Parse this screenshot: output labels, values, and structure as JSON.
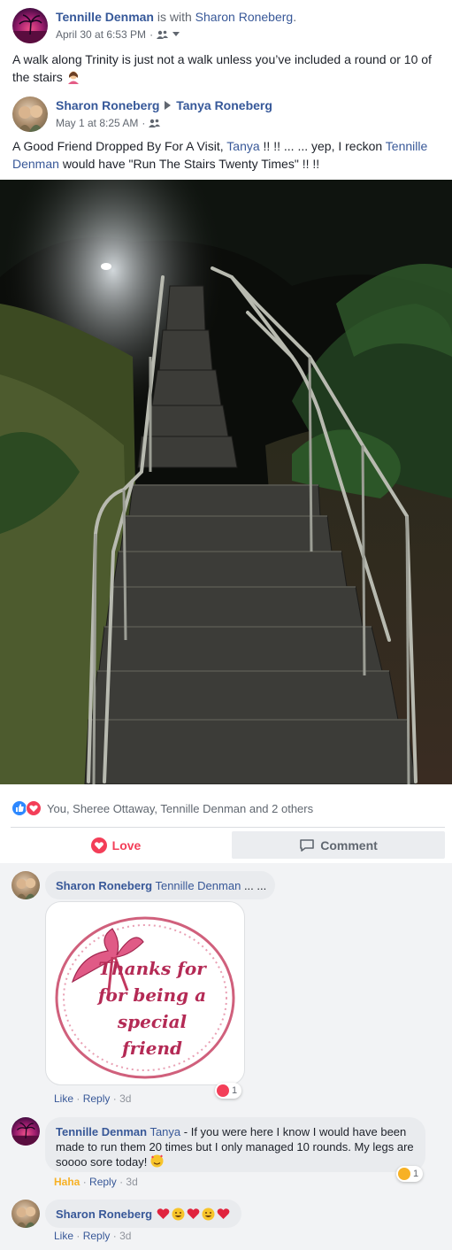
{
  "post": {
    "author": "Tennille Denman",
    "with_text": "is with",
    "tagged": "Sharon Roneberg",
    "tagged_suffix": ".",
    "date": "April 30 at 6:53 PM",
    "meta_sep": "·",
    "text": "A walk along Trinity is just not a walk unless you’ve included a round or 10 of the stairs"
  },
  "shared": {
    "author": "Sharon Roneberg",
    "target": "Tanya Roneberg",
    "date": "May 1 at 8:25 AM",
    "meta_sep": "·",
    "text_part1": "A Good Friend Dropped By For A Visit,",
    "mention1": "Tanya",
    "text_part2": "!! !! ... ... yep, I reckon",
    "mention2_line1": "Tennille",
    "mention2_line2": "Denman",
    "text_part3": "would have \"Run The Stairs Twenty Times\" !! !!"
  },
  "reactions": {
    "summary": "You, Sheree Ottaway, Tennille Denman and 2 others"
  },
  "actions": {
    "love_label": "Love",
    "comment_label": "Comment"
  },
  "comments": [
    {
      "author": "Sharon Roneberg",
      "mention": "Tennille Denman",
      "text": "... ...",
      "sticker_text": [
        "Thanks for",
        "for being a",
        "special",
        "friend"
      ],
      "like": "Like",
      "reply": "Reply",
      "sep": "·",
      "time": "3d",
      "reaction_count": "1"
    },
    {
      "author": "Tennille Denman",
      "mention": "Tanya",
      "text_line1": "- If you were here I know I would have been",
      "text_line2": "made to run them 20 times but I only managed 10 rounds. My legs are",
      "text_line3": "soooo sore today!",
      "reaction": "Haha",
      "reply": "Reply",
      "sep": "·",
      "time": "3d",
      "reaction_count": "1"
    },
    {
      "author": "Sharon Roneberg",
      "like": "Like",
      "reply": "Reply",
      "sep": "·",
      "time": "3d"
    }
  ],
  "colors": {
    "link": "#385898",
    "love": "#f33e58",
    "like": "#2d88ff",
    "haha": "#f7b125"
  }
}
